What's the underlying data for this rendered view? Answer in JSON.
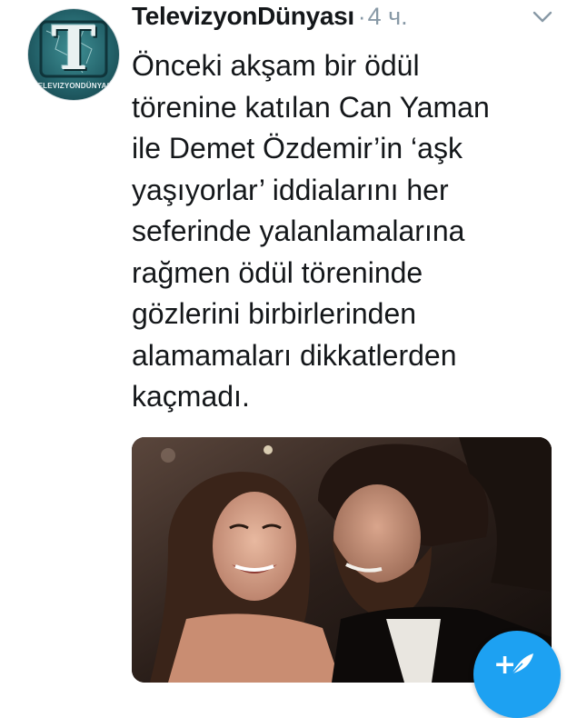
{
  "tweet": {
    "author": {
      "display_name": "TelevizyonDünyası",
      "avatar_logo_letter": "T",
      "avatar_logo_text": "TELEVIZYONDÜNYASI",
      "avatar_icon": "television-logo-icon"
    },
    "separator": "·",
    "timestamp": "4 ч.",
    "menu_icon": "chevron-down-icon",
    "text_lines": [
      "Önceki akşam bir ödül",
      "törenine katılan Can Yaman",
      "ile Demet Özdemir’in ‘aşk",
      "yaşıyorlar’ iddialarını her",
      "seferinde yalanlamalarına",
      "rağmen ödül töreninde",
      "gözlerini birbirlerinden",
      "alamamaları dikkatlerden",
      "kaçmadı."
    ],
    "media": {
      "type": "photo",
      "icon": "photo-icon"
    }
  },
  "compose_button": {
    "label": "+",
    "icon": "feather-compose-icon",
    "color": "#1da1f2"
  },
  "colors": {
    "text": "#14171a",
    "secondary_text": "#8899a6",
    "accent": "#1da1f2"
  }
}
